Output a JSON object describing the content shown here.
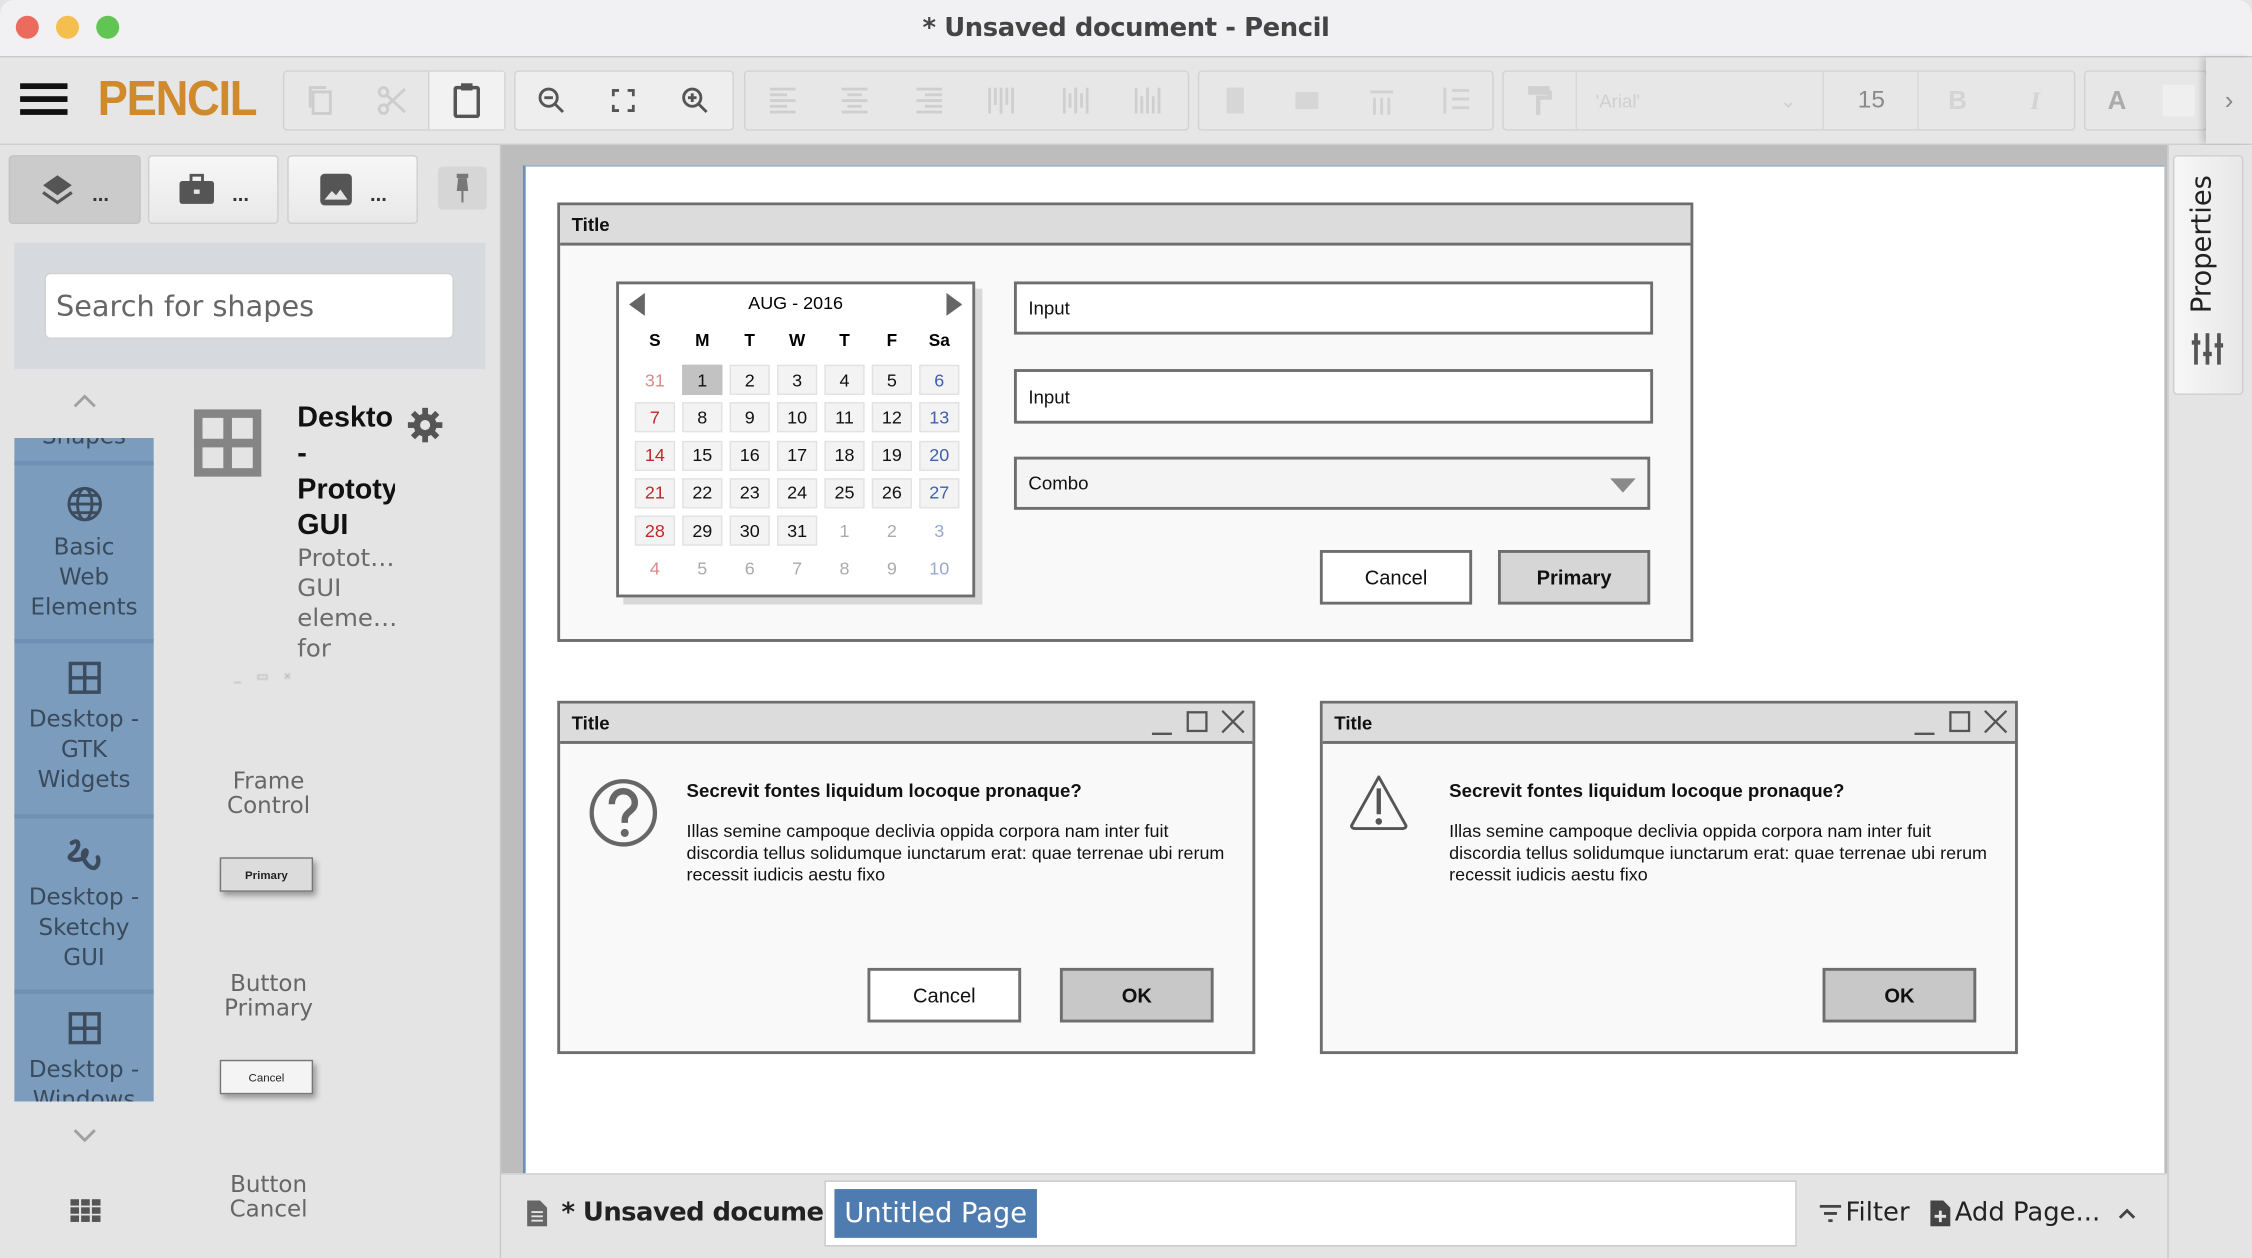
{
  "window": {
    "title": "* Unsaved document - Pencil",
    "traffic_colors": {
      "close": "#ed6a5e",
      "minimize": "#f5bf4f",
      "zoom": "#61c554"
    }
  },
  "toolbar": {
    "app_name": "PENCIL",
    "brand_color": "#cf8a2e",
    "font_family_value": "'Arial'",
    "font_size_value": "15",
    "bold_label": "B",
    "italic_label": "I",
    "text_color_label": "A",
    "buttons": [
      "copy",
      "cut",
      "paste",
      "zoom-out",
      "fit-screen",
      "zoom-in",
      "align-left",
      "align-center",
      "align-right",
      "align-top",
      "align-middle",
      "align-bottom",
      "same-height",
      "same-width",
      "h-spacing",
      "v-spacing",
      "format-painter"
    ]
  },
  "left_panel": {
    "tabs": [
      {
        "icon": "layers-icon",
        "label": "..."
      },
      {
        "icon": "briefcase-icon",
        "label": "..."
      },
      {
        "icon": "image-icon",
        "label": "..."
      }
    ],
    "search_placeholder": "Search for shapes",
    "categories": [
      {
        "label": "Shapes"
      },
      {
        "label": "Basic Web Elements",
        "lines": [
          "Basic",
          "Web",
          "Elements"
        ]
      },
      {
        "label": "Desktop - GTK Widgets",
        "lines": [
          "Desktop -",
          "GTK",
          "Widgets"
        ]
      },
      {
        "label": "Desktop - Sketchy GUI",
        "lines": [
          "Desktop -",
          "Sketchy",
          "GUI"
        ]
      },
      {
        "label": "Desktop - Windows",
        "lines": [
          "Desktop -",
          "Windows"
        ]
      }
    ],
    "collection": {
      "title_lines": [
        "Deskto|",
        "-",
        "Prototy",
        "GUI"
      ],
      "desc_lines": [
        "Protot…",
        "GUI",
        "eleme…",
        "for"
      ]
    },
    "shapes": [
      {
        "name": "Frame Control",
        "lines": [
          "Frame",
          "Control"
        ]
      },
      {
        "name": "Button Primary",
        "lines": [
          "Button",
          "Primary"
        ],
        "preview_label": "Primary"
      },
      {
        "name": "Button Cancel",
        "lines": [
          "Button",
          "Cancel"
        ],
        "preview_label": "Cancel"
      }
    ]
  },
  "canvas": {
    "frame1": {
      "title": "Title",
      "calendar": {
        "month_label": "AUG - 2016",
        "weekdays": [
          "S",
          "M",
          "T",
          "W",
          "T",
          "F",
          "Sa"
        ],
        "weeks": [
          [
            "31",
            "1",
            "2",
            "3",
            "4",
            "5",
            "6"
          ],
          [
            "7",
            "8",
            "9",
            "10",
            "11",
            "12",
            "13"
          ],
          [
            "14",
            "15",
            "16",
            "17",
            "18",
            "19",
            "20"
          ],
          [
            "21",
            "22",
            "23",
            "24",
            "25",
            "26",
            "27"
          ],
          [
            "28",
            "29",
            "30",
            "31",
            "1",
            "2",
            "3"
          ],
          [
            "4",
            "5",
            "6",
            "7",
            "8",
            "9",
            "10"
          ]
        ],
        "selected_day": "1",
        "colors": {
          "sunday": "#c0282a",
          "saturday": "#4060a8",
          "text": "#111111"
        }
      },
      "input1": "Input",
      "input2": "Input",
      "combo": "Combo",
      "cancel_label": "Cancel",
      "primary_label": "Primary"
    },
    "dialog_question": {
      "title": "Title",
      "heading": "Secrevit fontes liquidum locoque pronaque?",
      "body": "Illas semine campoque declivia oppida corpora nam inter fuit discordia tellus solidumque iunctarum erat: quae terrenae ubi rerum recessit iudicis aestu fixo",
      "cancel_label": "Cancel",
      "ok_label": "OK"
    },
    "dialog_warning": {
      "title": "Title",
      "heading": "Secrevit fontes liquidum locoque pronaque?",
      "body": "Illas semine campoque declivia oppida corpora nam inter fuit discordia tellus solidumque iunctarum erat: quae terrenae ubi rerum recessit iudicis aestu fixo",
      "ok_label": "OK"
    }
  },
  "right_panel": {
    "properties_label": "Properties"
  },
  "bottom_bar": {
    "document_label": "* Unsaved document",
    "active_page": "Untitled Page",
    "active_page_color": "#4e7cb0",
    "filter_label": "Filter",
    "add_page_label": "Add Page..."
  }
}
